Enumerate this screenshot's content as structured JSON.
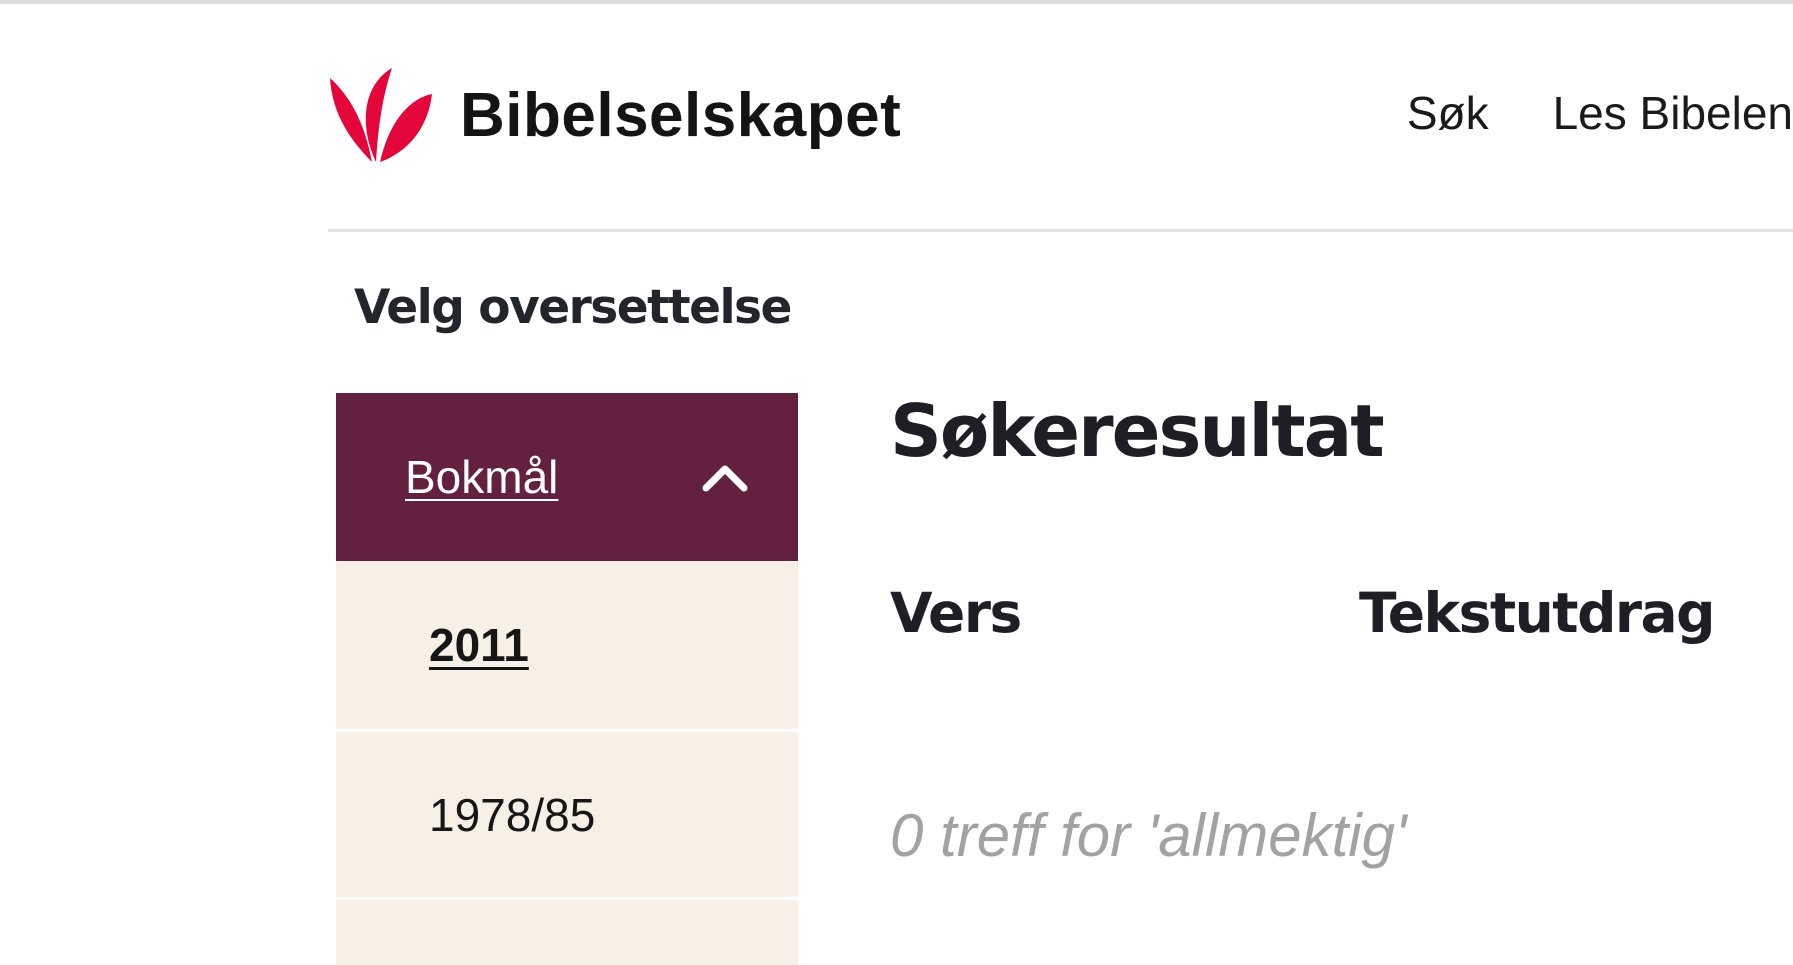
{
  "header": {
    "brand": "Bibelselskapet",
    "nav": [
      {
        "label": "Søk"
      },
      {
        "label": "Les Bibelen"
      }
    ]
  },
  "sidebar": {
    "title": "Velg oversettelse",
    "group_label": "Bokmål",
    "expanded": true,
    "items": [
      {
        "label": "2011",
        "active": true
      },
      {
        "label": "1978/85",
        "active": false
      }
    ]
  },
  "main": {
    "title": "Søkeresultat",
    "columns": [
      "Vers",
      "Tekstutdrag"
    ],
    "empty_message": "0 treff for 'allmektig'"
  },
  "colors": {
    "accordion_header": "#63203f",
    "accordion_item_bg": "#f7f0e6",
    "logo_red": "#e4063b",
    "muted_text": "#a2a2a2"
  }
}
